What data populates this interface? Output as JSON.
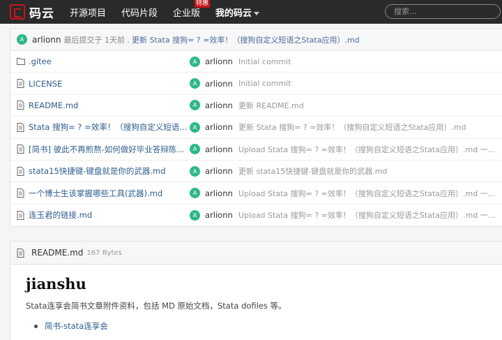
{
  "nav": {
    "logo_text": "码云",
    "links": [
      "开源项目",
      "代码片段",
      "企业版",
      "我的码云"
    ],
    "badge": "特惠",
    "search_placeholder": "搜索..."
  },
  "last_commit": {
    "avatar": "A",
    "author": "arlionn",
    "prefix": "最后提交于 1天前 .",
    "message": "更新 Stata 搜狗= ? =效率！（搜狗自定义短语之Stata应用）.md"
  },
  "files": [
    {
      "icon": "folder-icon",
      "name": ".gitee",
      "author": "arlionn",
      "message": "Initial commit"
    },
    {
      "icon": "file-icon",
      "name": "LICENSE",
      "author": "arlionn",
      "message": "Initial commit"
    },
    {
      "icon": "file-icon",
      "name": "README.md",
      "author": "arlionn",
      "message": "更新 README.md"
    },
    {
      "icon": "file-icon",
      "name": "Stata 搜狗= ? =效率！（搜狗自定义短语...",
      "author": "arlionn",
      "message": "更新 Stata 搜狗= ? =效率！（搜狗自定义短语之Stata应用）.md"
    },
    {
      "icon": "file-icon",
      "name": "[简书] 彼此不再煎熬-如何做好毕业答辩陈...",
      "author": "arlionn",
      "message": "Upload Stata 搜狗= ? =效率！（搜狗自定义短语之Stata应用）.md 一..."
    },
    {
      "icon": "file-icon",
      "name": "stata15快捷键-键盘就是你的武器.md",
      "author": "arlionn",
      "message": "更新 stata15快捷键-键盘就是你的武器.md"
    },
    {
      "icon": "file-icon",
      "name": "一个博士生该掌握哪些工具(武器).md",
      "author": "arlionn",
      "message": "Upload Stata 搜狗= ? =效率！（搜狗自定义短语之Stata应用）.md 一..."
    },
    {
      "icon": "file-icon",
      "name": "连玉君的链接.md",
      "author": "arlionn",
      "message": "Upload Stata 搜狗= ? =效率！（搜狗自定义短语之Stata应用）.md 一..."
    }
  ],
  "readme": {
    "file_name": "README.md",
    "size": "167 Bytes",
    "title": "jianshu",
    "description": "Stata连享会简书文章附件资料，包括 MD 原始文档，Stata dofiles 等。",
    "list": [
      "简书-stata连享会"
    ]
  },
  "colors": {
    "nav_bg": "#2a2a2a",
    "brand_red": "#c7161c",
    "avatar_green": "#2eb885",
    "link_blue": "#2f5d8f"
  }
}
